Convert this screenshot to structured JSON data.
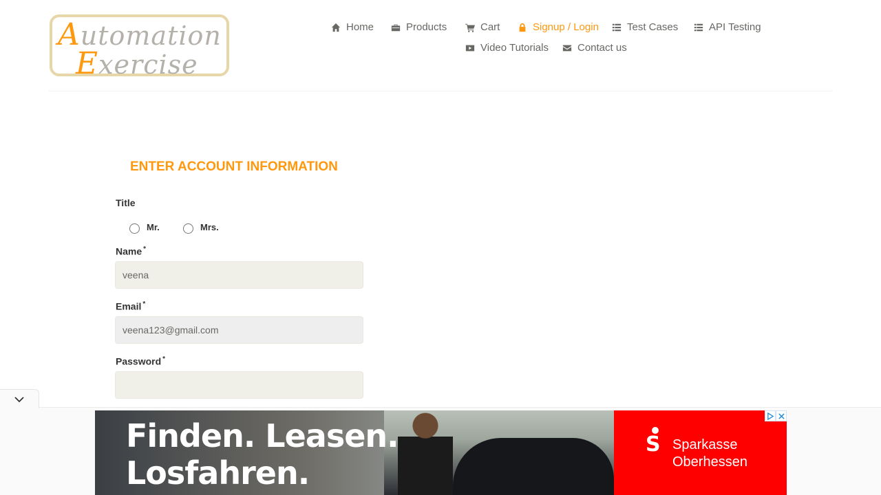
{
  "header": {
    "logo_word1": "Automation",
    "logo_word2": "Exercise",
    "nav": [
      {
        "label": "Home",
        "icon": "home-icon"
      },
      {
        "label": "Products",
        "icon": "briefcase-icon"
      },
      {
        "label": "Cart",
        "icon": "cart-icon"
      },
      {
        "label": "Signup / Login",
        "icon": "lock-icon",
        "active": true
      },
      {
        "label": "Test Cases",
        "icon": "list-icon"
      },
      {
        "label": "API Testing",
        "icon": "list-icon"
      },
      {
        "label": "Video Tutorials",
        "icon": "youtube-icon"
      },
      {
        "label": "Contact us",
        "icon": "envelope-icon"
      }
    ]
  },
  "form": {
    "title": "ENTER ACCOUNT INFORMATION",
    "title_label": "Title",
    "title_options": [
      "Mr.",
      "Mrs."
    ],
    "name_label": "Name",
    "name_value": "veena",
    "email_label": "Email",
    "email_value": "veena123@gmail.com",
    "password_label": "Password",
    "password_value": "",
    "required_mark": "*"
  },
  "ad": {
    "headline_line1": "Finden. Leasen.",
    "headline_line2": "Losfahren.",
    "brand_line1": "Sparkasse",
    "brand_line2": "Oberhessen"
  },
  "colors": {
    "accent": "#fe980f",
    "text": "#696763",
    "ad_brand": "#ff0000"
  }
}
